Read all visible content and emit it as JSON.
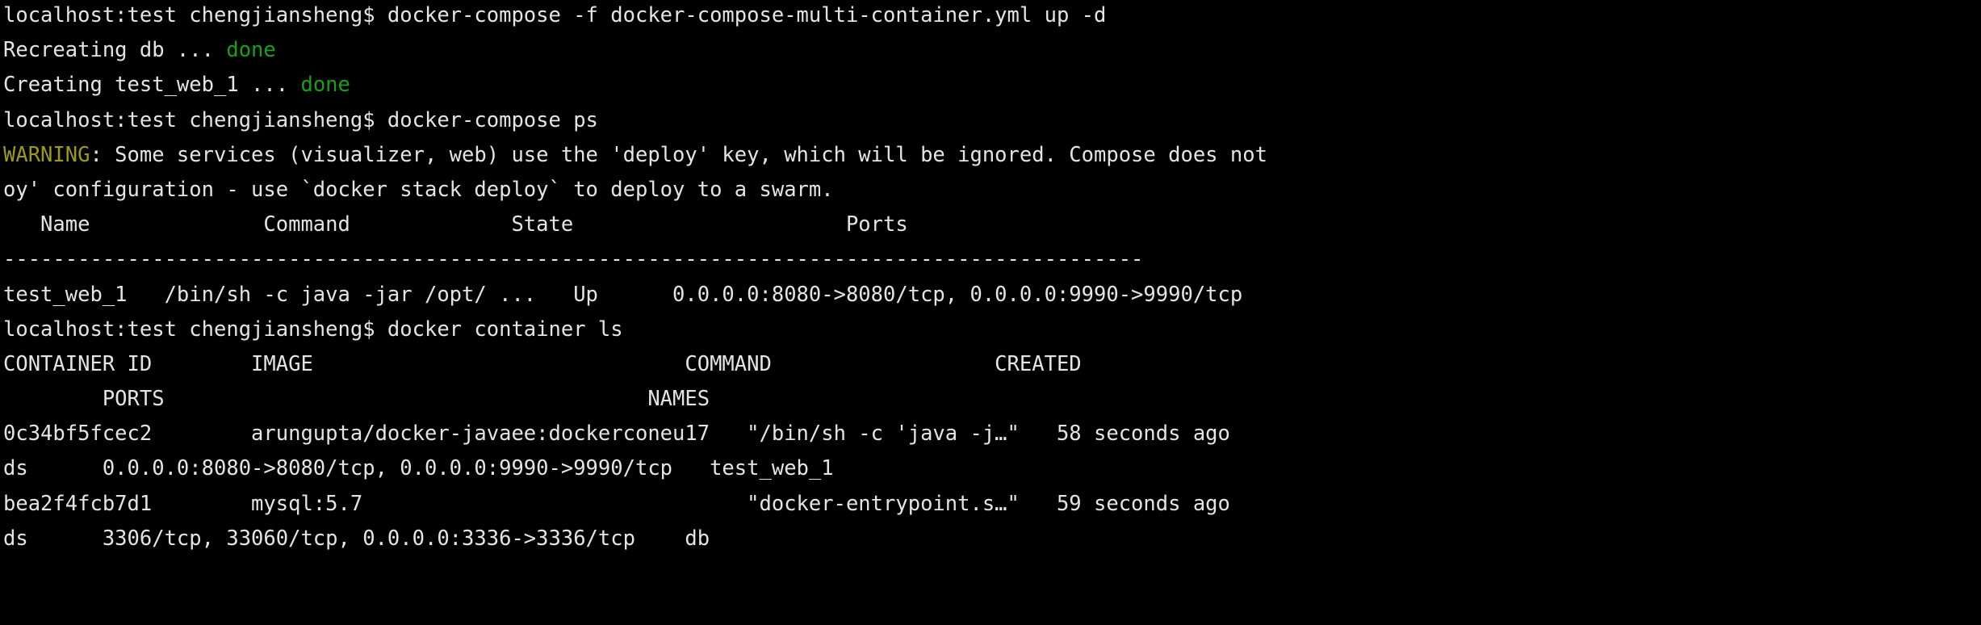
{
  "terminal": {
    "title": "docker-compose terminal session",
    "background_color": "#000000",
    "foreground_color": "#e4e4e4",
    "green_color": "#19a019",
    "yellow_color": "#9b9b18",
    "prompt": "localhost:test chengjiansheng$",
    "columns": 162,
    "lines": [
      {
        "id": "line-1-command-compose-up",
        "segments": [
          {
            "text": "localhost:test chengjiansheng$ docker-compose -f docker-compose-multi-container.yml up -d",
            "color": "default"
          }
        ]
      },
      {
        "id": "line-2-recreating-db",
        "segments": [
          {
            "text": "Recreating db ... ",
            "color": "default"
          },
          {
            "text": "done",
            "color": "green"
          }
        ]
      },
      {
        "id": "line-3-creating-test-web-1",
        "segments": [
          {
            "text": "Creating test_web_1 ... ",
            "color": "default"
          },
          {
            "text": "done",
            "color": "green"
          }
        ]
      },
      {
        "id": "line-4-command-compose-ps",
        "segments": [
          {
            "text": "localhost:test chengjiansheng$ docker-compose ps",
            "color": "default"
          }
        ]
      },
      {
        "id": "line-5-warning-deploy-key",
        "segments": [
          {
            "text": "WARNING",
            "color": "yellow"
          },
          {
            "text": ": Some services (visualizer, web) use the 'deploy' key, which will be ignored. Compose does not",
            "color": "default"
          }
        ]
      },
      {
        "id": "line-6-warning-continued",
        "segments": [
          {
            "text": "oy' configuration - use `docker stack deploy` to deploy to a swarm.",
            "color": "default"
          }
        ]
      },
      {
        "id": "line-7-ps-header",
        "segments": [
          {
            "text": "   Name              Command             State                      Ports",
            "color": "default"
          }
        ]
      },
      {
        "id": "line-8-ps-separator",
        "segments": [
          {
            "text": "--------------------------------------------------------------------------------------------",
            "color": "default"
          }
        ]
      },
      {
        "id": "line-9-ps-row-test-web-1",
        "segments": [
          {
            "text": "test_web_1   /bin/sh -c java -jar /opt/ ...   Up      0.0.0.0:8080->8080/tcp, 0.0.0.0:9990->9990/tcp",
            "color": "default"
          }
        ]
      },
      {
        "id": "line-10-command-container-ls",
        "segments": [
          {
            "text": "localhost:test chengjiansheng$ docker container ls",
            "color": "default"
          }
        ]
      },
      {
        "id": "line-11-ls-header",
        "segments": [
          {
            "text": "CONTAINER ID        IMAGE                              COMMAND                  CREATED",
            "color": "default"
          }
        ]
      },
      {
        "id": "line-12-ls-header-continued",
        "segments": [
          {
            "text": "        PORTS                                       NAMES",
            "color": "default"
          }
        ]
      },
      {
        "id": "line-13-ls-row-web",
        "segments": [
          {
            "text": "0c34bf5fcec2        arungupta/docker-javaee:dockerconeu17   \"/bin/sh -c 'java -j…\"   58 seconds ago",
            "color": "default"
          }
        ]
      },
      {
        "id": "line-14-ls-row-web-continued",
        "segments": [
          {
            "text": "ds      0.0.0.0:8080->8080/tcp, 0.0.0.0:9990->9990/tcp   test_web_1",
            "color": "default"
          }
        ]
      },
      {
        "id": "line-15-ls-row-db",
        "segments": [
          {
            "text": "bea2f4fcb7d1        mysql:5.7                               \"docker-entrypoint.s…\"   59 seconds ago",
            "color": "default"
          }
        ]
      },
      {
        "id": "line-16-ls-row-db-continued",
        "segments": [
          {
            "text": "ds      3306/tcp, 33060/tcp, 0.0.0.0:3336->3336/tcp    db",
            "color": "default"
          }
        ]
      }
    ]
  }
}
